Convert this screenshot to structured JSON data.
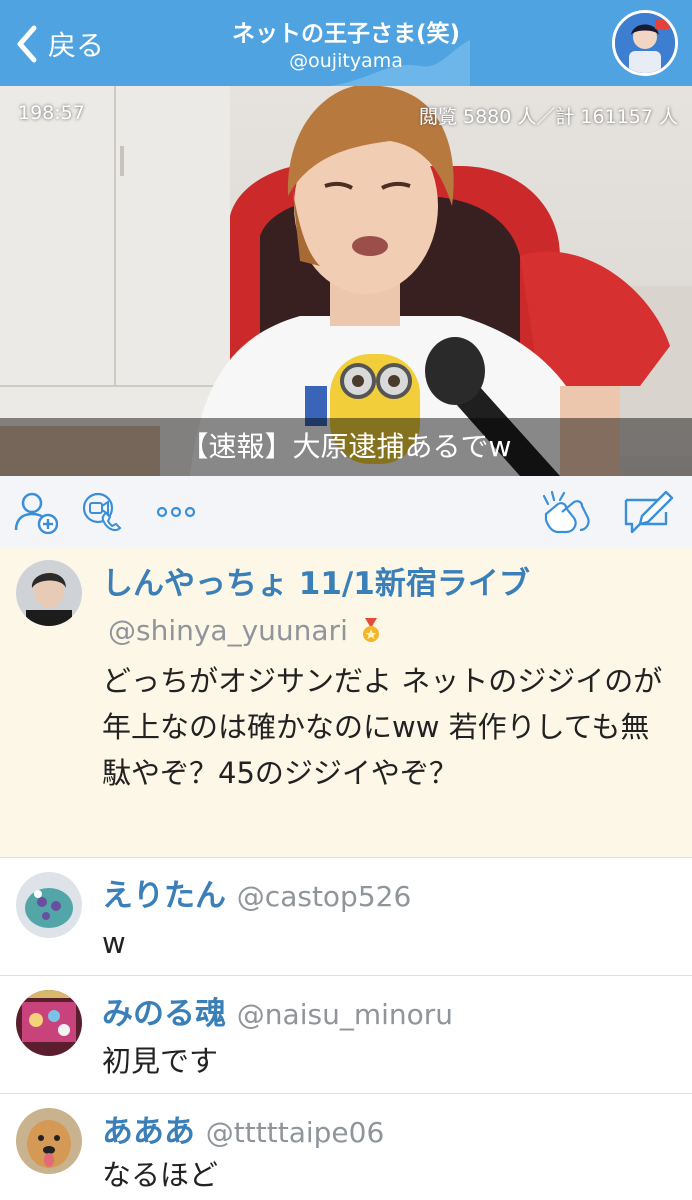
{
  "header": {
    "back_label": "戻る",
    "title": "ネットの王子さま(笑)",
    "handle": "@oujityama"
  },
  "video": {
    "elapsed": "198:57",
    "views": "閲覧 5880 人／計 161157 人",
    "caption": "【速報】大原逮捕あるでw"
  },
  "toolbar": {
    "icons": [
      "add-user-icon",
      "video-call-icon",
      "more-icon",
      "clap-icon",
      "compose-icon"
    ]
  },
  "comments": [
    {
      "name": "しんやっちょ 11/1新宿ライブ",
      "handle": "@shinya_yuunari",
      "badge": "medal-icon",
      "text": "どっちがオジサンだよ ネットのジジイのが年上なのは確かなのにww 若作りしても無駄やぞ？45のジジイやぞ？",
      "highlight": true
    },
    {
      "name": "えりたん",
      "handle": "@castop526",
      "text": "w"
    },
    {
      "name": "みのる魂",
      "handle": "@naisu_minoru",
      "text": "初見です"
    },
    {
      "name": "あああ",
      "handle": "@tttttaipe06",
      "text": "なるほど"
    }
  ],
  "colors": {
    "header_bg": "#4fa3e0",
    "accent": "#3a7fb8",
    "highlight_bg": "#fdf7e7",
    "toolbar_bg": "#f3f5f9"
  }
}
